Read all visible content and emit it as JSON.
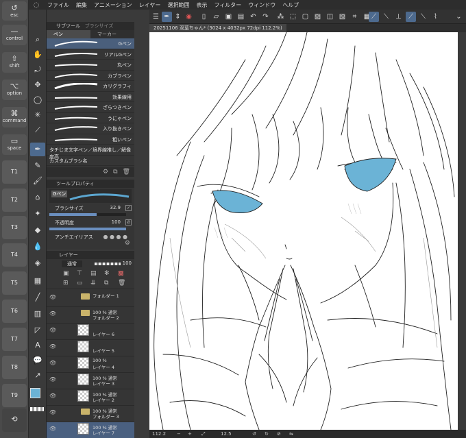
{
  "keys": {
    "esc": "esc",
    "control": "control",
    "shift": "shift",
    "option": "option",
    "command": "command",
    "space": "space",
    "tkeys": [
      "T1",
      "T2",
      "T3",
      "T4",
      "T5",
      "T6",
      "T7",
      "T8",
      "T9"
    ]
  },
  "menu": [
    "ファイル",
    "編集",
    "アニメーション",
    "レイヤー",
    "選択範囲",
    "表示",
    "フィルター",
    "ウィンドウ",
    "ヘルプ"
  ],
  "subtool": {
    "title": "サブツール",
    "title2": "ブラシサイズ",
    "tabs": [
      "ペン",
      "マーカー"
    ],
    "brushes": [
      "Gペン",
      "リアルGペン",
      "丸ペン",
      "カブラペン",
      "カリグラフィ",
      "効果線用",
      "ざらつきペン",
      "うにゃペン",
      "入り抜きペン",
      "粗いペン",
      "タチじま文字ペン／境界線推し／解像度高",
      "カスタムブラシ名"
    ]
  },
  "toolprop": {
    "title": "ツールプロパティ",
    "preset": "Gペン",
    "size_label": "ブラシサイズ",
    "size_value": "32.9",
    "opacity_label": "不透明度",
    "opacity_value": "100",
    "aa_label": "アンチエイリアス"
  },
  "layers": {
    "title": "レイヤー",
    "blend": "通常",
    "opacity": "100",
    "rows": [
      {
        "t1": "フォルダー 1",
        "t2": ""
      },
      {
        "t1": "100 % 通常",
        "t2": "フォルダー 2"
      },
      {
        "t1": "",
        "t2": "レイヤー 6"
      },
      {
        "t1": "",
        "t2": "レイヤー 5"
      },
      {
        "t1": "100 %",
        "t2": "レイヤー 4"
      },
      {
        "t1": "100 % 通常",
        "t2": "レイヤー 3"
      },
      {
        "t1": "100 % 通常",
        "t2": "レイヤー 2"
      },
      {
        "t1": "100 % 通常",
        "t2": "フォルダー 3"
      },
      {
        "t1": "100 % 通常",
        "t2": "レイヤー 7"
      }
    ]
  },
  "document": {
    "tab_title": "20251106 双葉ちゃん* (3024 x 4032px 72dpi 112.2%)"
  },
  "status": {
    "zoom": "112.2",
    "angle": "12.5"
  },
  "colors": {
    "accent": "#4a6080",
    "fill": "#6bb3d6",
    "canvas": "#ffffff"
  }
}
